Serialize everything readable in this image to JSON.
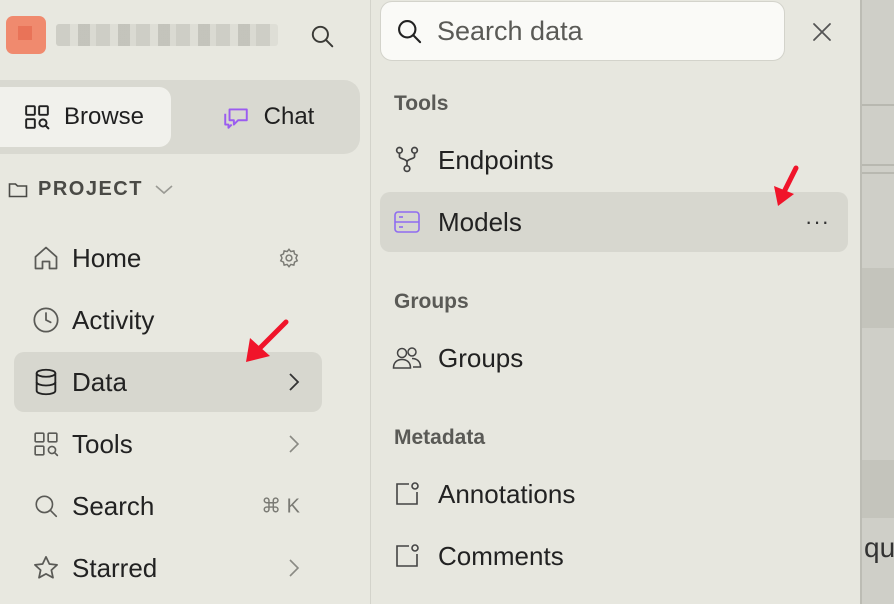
{
  "sidebar": {
    "workspace_name": "",
    "modes": {
      "browse": "Browse",
      "chat": "Chat"
    },
    "section_label": "PROJECT",
    "items": [
      {
        "label": "Home",
        "icon": "home-icon"
      },
      {
        "label": "Activity",
        "icon": "clock-icon"
      },
      {
        "label": "Data",
        "icon": "database-icon"
      },
      {
        "label": "Tools",
        "icon": "grid-search-icon"
      },
      {
        "label": "Search",
        "icon": "search-icon",
        "shortcut": "⌘ K"
      },
      {
        "label": "Starred",
        "icon": "star-icon"
      }
    ]
  },
  "panel": {
    "search": {
      "placeholder": "Search data",
      "value": ""
    },
    "groups": [
      {
        "title": "Tools",
        "items": [
          "Endpoints",
          "Models"
        ]
      },
      {
        "title": "Groups",
        "items": [
          "Groups"
        ]
      },
      {
        "title": "Metadata",
        "items": [
          "Annotations",
          "Comments"
        ]
      }
    ],
    "more_label": "···"
  },
  "backdrop": {
    "partial_text": "que"
  },
  "colors": {
    "accent_purple": "#9b5cf0",
    "annotation_red": "#f0142a",
    "logo_orange": "#f08a6e",
    "active_bg": "#d7d7cf"
  }
}
